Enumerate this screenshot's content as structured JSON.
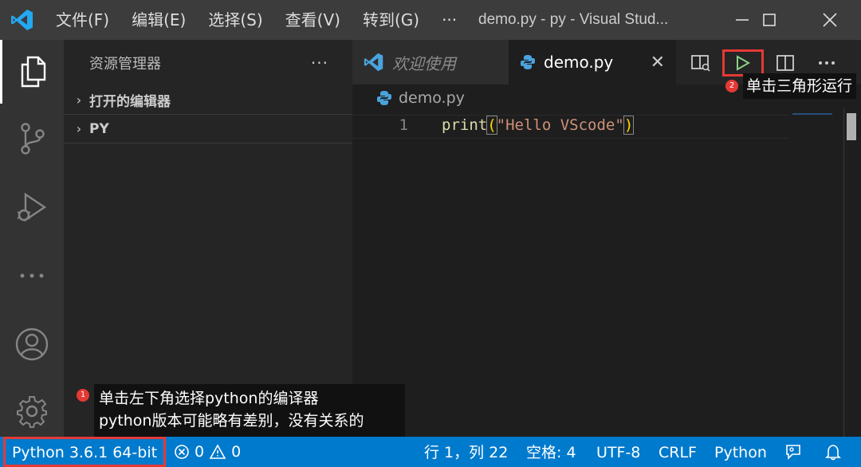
{
  "titlebar": {
    "menus": [
      "文件(F)",
      "编辑(E)",
      "选择(S)",
      "查看(V)",
      "转到(G)",
      "···"
    ],
    "window_title": "demo.py - py - Visual Stud...",
    "colors": {
      "logo": "#23a9f2",
      "bar": "#3c3c3c"
    }
  },
  "activitybar": {
    "items": [
      "explorer-icon",
      "source-control-icon",
      "run-debug-icon",
      "more-icon",
      "account-icon",
      "settings-gear-icon"
    ]
  },
  "sidebar": {
    "title": "资源管理器",
    "more": "···",
    "sections": [
      {
        "label": "打开的编辑器",
        "expanded": false
      },
      {
        "label": "PY",
        "expanded": false
      }
    ]
  },
  "tabs": [
    {
      "label": "欢迎使用",
      "active": false
    },
    {
      "label": "demo.py",
      "active": true,
      "close": "✕"
    }
  ],
  "editor": {
    "breadcrumb": "demo.py",
    "lines": [
      {
        "number": "1",
        "tokens": {
          "fn": "print",
          "open": "(",
          "str": "\"Hello VScode\"",
          "close": ")"
        }
      }
    ]
  },
  "actions": [
    "open-preview-icon",
    "run-triangle-icon",
    "split-editor-icon",
    "more-actions-icon"
  ],
  "statusbar": {
    "interpreter": "Python 3.6.1 64-bit",
    "errors": "0",
    "warnings": "0",
    "position": "行 1，列 22",
    "spaces": "空格: 4",
    "encoding": "UTF-8",
    "eol": "CRLF",
    "language": "Python"
  },
  "annotations": {
    "note1": {
      "badge": "1",
      "line1": "单击左下角选择python的编译器",
      "line2": "python版本可能略有差别，没有关系的"
    },
    "note2": {
      "badge": "2",
      "text": "单击三角形运行"
    },
    "highlight_color": "#e53935"
  }
}
